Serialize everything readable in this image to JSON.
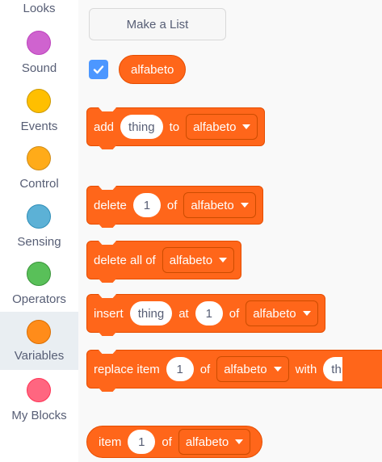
{
  "sidebar": {
    "categories": [
      {
        "label": "Looks",
        "color": "#9966ff"
      },
      {
        "label": "Sound",
        "color": "#cf63cf"
      },
      {
        "label": "Events",
        "color": "#ffbf00"
      },
      {
        "label": "Control",
        "color": "#ffab19"
      },
      {
        "label": "Sensing",
        "color": "#5cb1d6"
      },
      {
        "label": "Operators",
        "color": "#59c059"
      },
      {
        "label": "Variables",
        "color": "#ff8c1a",
        "selected": true
      },
      {
        "label": "My Blocks",
        "color": "#ff6680"
      }
    ]
  },
  "palette": {
    "make_list_label": "Make a List",
    "list_variable": "alfabeto",
    "list_checked": true,
    "blocks": {
      "add": {
        "word1": "add",
        "input1": "thing",
        "word2": "to",
        "list": "alfabeto"
      },
      "delete": {
        "word1": "delete",
        "input1": "1",
        "word2": "of",
        "list": "alfabeto"
      },
      "delete_all": {
        "word1": "delete all of",
        "list": "alfabeto"
      },
      "insert": {
        "word1": "insert",
        "input1": "thing",
        "word2": "at",
        "input2": "1",
        "word3": "of",
        "list": "alfabeto"
      },
      "replace": {
        "word1": "replace item",
        "input1": "1",
        "word2": "of",
        "list": "alfabeto",
        "word3": "with",
        "input2": "th"
      },
      "item": {
        "word1": "item",
        "input1": "1",
        "word2": "of",
        "list": "alfabeto"
      }
    }
  },
  "colors": {
    "list_block": "#ff661a",
    "checkbox": "#4c97ff",
    "selected_category_bg": "#e9eef2"
  }
}
